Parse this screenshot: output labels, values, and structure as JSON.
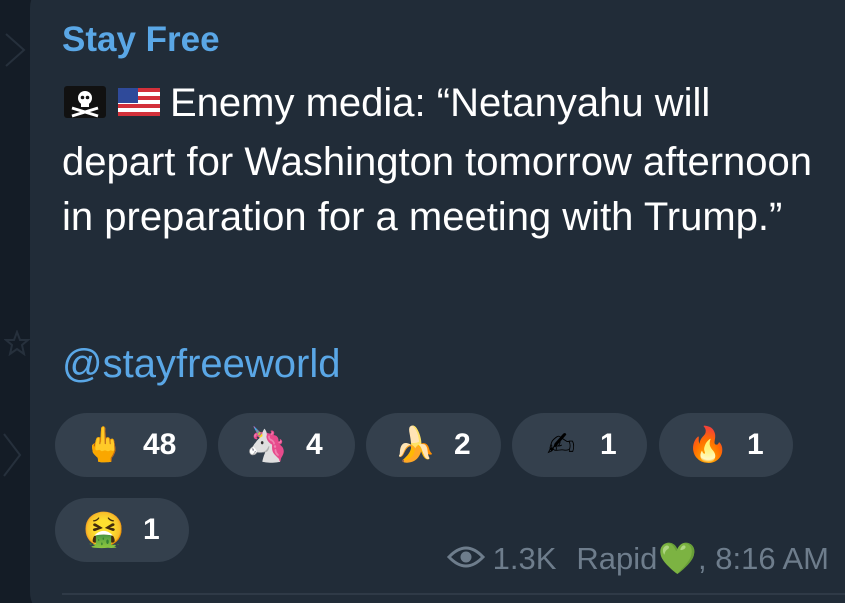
{
  "message": {
    "sender": "Stay Free",
    "text": "Enemy media: “Netanyahu will depart for Washington tomorrow afternoon in preparation for a meeting with Trump.”",
    "prefix_emojis": [
      "pirate-flag",
      "us-flag"
    ],
    "mention": "@stayfreeworld"
  },
  "reactions": [
    {
      "emoji": "🖕",
      "icon": "middle-finger-emoji",
      "count": "48"
    },
    {
      "emoji": "🦄",
      "icon": "unicorn-emoji",
      "count": "4"
    },
    {
      "emoji": "🍌",
      "icon": "banana-emoji",
      "count": "2"
    },
    {
      "emoji": "✍",
      "icon": "writing-hand-emoji",
      "count": "1"
    },
    {
      "emoji": "🔥",
      "icon": "fire-emoji",
      "count": "1"
    },
    {
      "emoji": "🤮",
      "icon": "vomiting-face-emoji",
      "count": "1"
    }
  ],
  "footer": {
    "views": "1.3K",
    "signature": "Rapid",
    "signature_emoji": "💚",
    "time": ", 8:16 AM"
  },
  "colors": {
    "background": "#141c26",
    "bubble": "#212c38",
    "accent": "#5aa7e6",
    "reaction_bg": "#34404d",
    "meta_text": "#6e7d8c"
  }
}
